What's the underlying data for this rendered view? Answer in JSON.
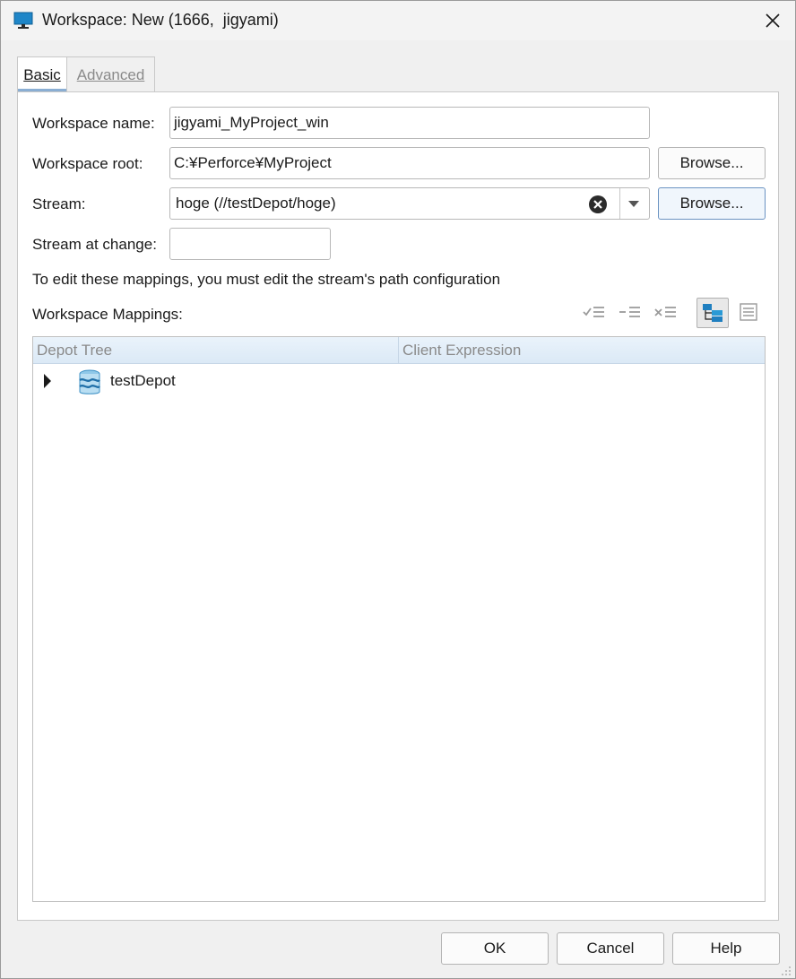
{
  "window": {
    "title": "Workspace: New (1666,  jigyami)",
    "icon": "monitor-icon"
  },
  "tabs": [
    {
      "label": "Basic",
      "active": true
    },
    {
      "label": "Advanced",
      "active": false
    }
  ],
  "form": {
    "workspace_name": {
      "label": "Workspace name:",
      "value": "jigyami_MyProject_win"
    },
    "workspace_root": {
      "label": "Workspace root:",
      "value": "C:¥Perforce¥MyProject",
      "browse_label": "Browse..."
    },
    "stream": {
      "label": "Stream:",
      "value": "hoge (//testDepot/hoge)",
      "browse_label": "Browse..."
    },
    "stream_at_change": {
      "label": "Stream at change:",
      "value": ""
    }
  },
  "info_text": "To edit these mappings, you must edit the stream's path configuration",
  "mappings": {
    "label": "Workspace Mappings:",
    "toolbar": [
      "include-icon",
      "exclude-icon",
      "remove-icon",
      "tree-view-icon",
      "text-view-icon"
    ],
    "columns": [
      "Depot Tree",
      "Client Expression"
    ],
    "rows": [
      {
        "label": "testDepot",
        "icon": "depot-icon",
        "expanded": false
      }
    ]
  },
  "footer": {
    "ok": "OK",
    "cancel": "Cancel",
    "help": "Help"
  },
  "colors": {
    "accent": "#6b93c2",
    "tab_indicator": "#8aaed3",
    "header_bg": "#dbe9f6"
  }
}
